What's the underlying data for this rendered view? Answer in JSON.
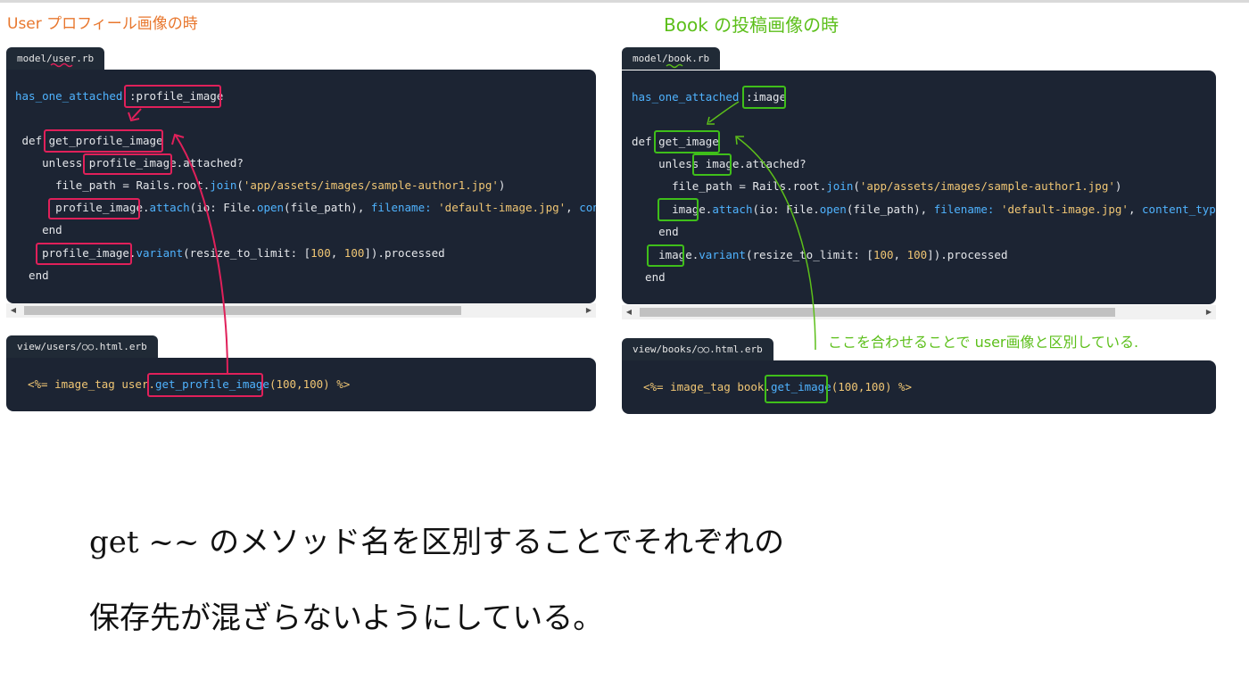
{
  "notes": {
    "user_title": "User プロフィール画像の時",
    "book_title": "Book の投稿画像の時",
    "green_note": "ここを合わせることで user画像と区別している.",
    "hand_line1": "get ~~ のメソッド名を区別することでそれぞれの",
    "hand_line2": "保存先が混ざらないようにしている。"
  },
  "left": {
    "model_tab": "model/user.rb",
    "view_tab": "view/users/○○.html.erb",
    "model_lines": {
      "l1a": "has_one_attached",
      "l1b": " :profile_image",
      "l2": " def get_profile_image",
      "l3": "    unless profile_image.attached?",
      "l4a": "      file_path = Rails.root.",
      "l4b": "join",
      "l4c": "(",
      "l4d": "'app/assets/images/sample-author1.jpg'",
      "l4e": ")",
      "l5a": "      profile_image.",
      "l5b": "attach",
      "l5c": "(io: File.",
      "l5d": "open",
      "l5e": "(file_path), ",
      "l5f": "filename:",
      "l5g": " ",
      "l5h": "'default-image.jpg'",
      "l5i": ", ",
      "l5j": "content_type:",
      "l6": "    end",
      "l7a": "    profile_image.",
      "l7b": "variant",
      "l7c": "(resize_to_limit: [",
      "l7d": "100",
      "l7e": ", ",
      "l7f": "100",
      "l7g": "]).processed",
      "l8": "  end"
    },
    "view_line": {
      "a": "<%= image_tag user.",
      "b": "get_profile_image",
      "c": "(100,100) %>"
    }
  },
  "right": {
    "model_tab": "model/book.rb",
    "view_tab": "view/books/○○.html.erb",
    "model_lines": {
      "l1a": "has_one_attached",
      "l1b": " :image",
      "l2": "def get_image",
      "l3": "    unless image.attached?",
      "l4a": "      file_path = Rails.root.",
      "l4b": "join",
      "l4c": "(",
      "l4d": "'app/assets/images/sample-author1.jpg'",
      "l4e": ")",
      "l5a": "      image.",
      "l5b": "attach",
      "l5c": "(io: File.",
      "l5d": "open",
      "l5e": "(file_path), ",
      "l5f": "filename:",
      "l5g": " ",
      "l5h": "'default-image.jpg'",
      "l5i": ", ",
      "l5j": "content_type:",
      "l6": "    end",
      "l7a": "    image.",
      "l7b": "variant",
      "l7c": "(resize_to_limit: [",
      "l7d": "100",
      "l7e": ", ",
      "l7f": "100",
      "l7g": "]).processed",
      "l8": "  end"
    },
    "view_line": {
      "a": "<%= image_tag book.",
      "b": "get_image",
      "c": "(100,100) %>"
    }
  },
  "colors": {
    "pink": "#e0205a",
    "green": "#3fbf1a",
    "code_bg": "#1c2433"
  },
  "icons": [
    "scroll-left-arrow-icon",
    "scroll-right-arrow-icon"
  ]
}
